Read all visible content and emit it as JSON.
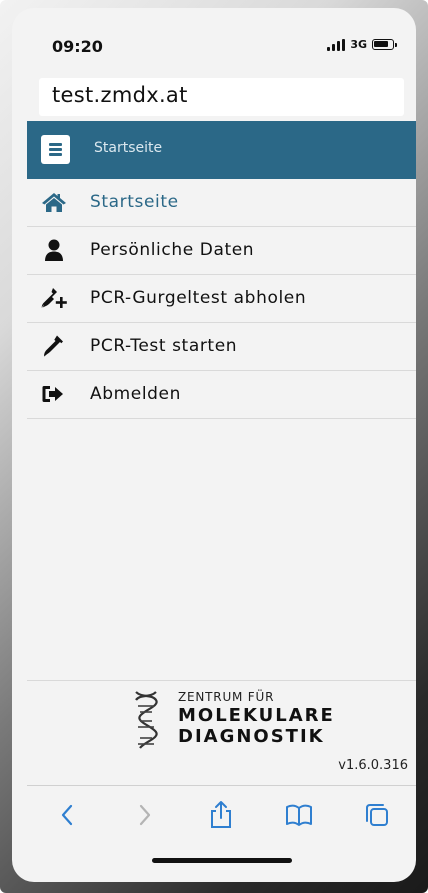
{
  "status_bar": {
    "time": "09:20",
    "network": "3G"
  },
  "browser": {
    "url": "test.zmdx.at"
  },
  "header": {
    "title": "Startseite",
    "accent_color": "#2b6887"
  },
  "nav": {
    "items": [
      {
        "label": "Startseite",
        "icon": "home-icon",
        "active": true
      },
      {
        "label": "Persönliche Daten",
        "icon": "user-icon",
        "active": false
      },
      {
        "label": "PCR-Gurgeltest abholen",
        "icon": "add-test-tube-icon",
        "active": false
      },
      {
        "label": "PCR-Test starten",
        "icon": "test-tube-icon",
        "active": false
      },
      {
        "label": "Abmelden",
        "icon": "sign-out-icon",
        "active": false
      }
    ]
  },
  "footer": {
    "logo_line1": "ZENTRUM FÜR",
    "logo_line2": "MOLEKULARE",
    "logo_line3": "DIAGNOSTIK",
    "version": "v1.6.0.316"
  },
  "toolbar": {
    "items": [
      "back-icon",
      "forward-icon",
      "share-icon",
      "bookmarks-icon",
      "tabs-icon"
    ]
  }
}
